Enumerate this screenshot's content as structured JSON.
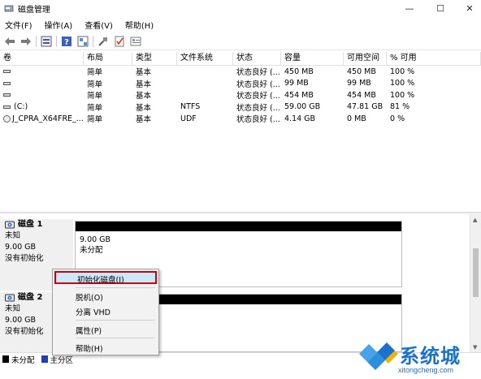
{
  "window": {
    "title": "磁盘管理",
    "controls": {
      "minimize": "—",
      "maximize": "☐",
      "close": "✕"
    }
  },
  "menu": [
    "文件(F)",
    "操作(A)",
    "查看(V)",
    "帮助(H)"
  ],
  "toolbar": [
    "back-arrow-icon",
    "forward-arrow-icon",
    "volume-list-icon",
    "help-icon",
    "properties-icon",
    "disk-icon",
    "connect-icon",
    "check-icon",
    "settings-icon"
  ],
  "volume_table": {
    "columns": [
      "卷",
      "布局",
      "类型",
      "文件系统",
      "状态",
      "容量",
      "可用空间",
      "% 可用"
    ],
    "rows": [
      {
        "volume": "",
        "layout": "简单",
        "type": "基本",
        "fs": "",
        "status": "状态良好 (...",
        "capacity": "450 MB",
        "free": "450 MB",
        "pct": "100 %"
      },
      {
        "volume": "",
        "layout": "简单",
        "type": "基本",
        "fs": "",
        "status": "状态良好 (...",
        "capacity": "99 MB",
        "free": "99 MB",
        "pct": "100 %"
      },
      {
        "volume": "",
        "layout": "简单",
        "type": "基本",
        "fs": "",
        "status": "状态良好 (...",
        "capacity": "454 MB",
        "free": "454 MB",
        "pct": "100 %"
      },
      {
        "volume": "(C:)",
        "layout": "简单",
        "type": "基本",
        "fs": "NTFS",
        "status": "状态良好 (...",
        "capacity": "59.00 GB",
        "free": "47.81 GB",
        "pct": "81 %"
      },
      {
        "volume": "J_CPRA_X64FRE_...",
        "layout": "简单",
        "type": "基本",
        "fs": "UDF",
        "status": "状态良好 (...",
        "capacity": "4.14 GB",
        "free": "0 MB",
        "pct": "0 %"
      }
    ]
  },
  "disks": [
    {
      "name": "磁盘 1",
      "type": "未知",
      "size": "9.00 GB",
      "state": "没有初始化",
      "partition": {
        "size": "9.00 GB",
        "label": "未分配"
      }
    },
    {
      "name": "磁盘 2",
      "type": "未知",
      "size": "9.00 GB",
      "state": "没有初始化"
    }
  ],
  "context_menu": {
    "items": [
      "初始化磁盘(I)",
      "脱机(O)",
      "分离 VHD",
      "属性(P)",
      "帮助(H)"
    ],
    "highlighted": "初始化磁盘(I)"
  },
  "legend": [
    {
      "label": "未分配",
      "color": "#000000"
    },
    {
      "label": "主分区",
      "color": "#1f3fb0"
    }
  ],
  "watermark": {
    "brand": "系统城",
    "url": "xitongcheng.com"
  },
  "colors": {
    "highlight_bg": "#cce8ff",
    "highlight_border": "#cc0000",
    "brand_blue": "#1a73c8",
    "primary_partition": "#1f3fb0"
  }
}
